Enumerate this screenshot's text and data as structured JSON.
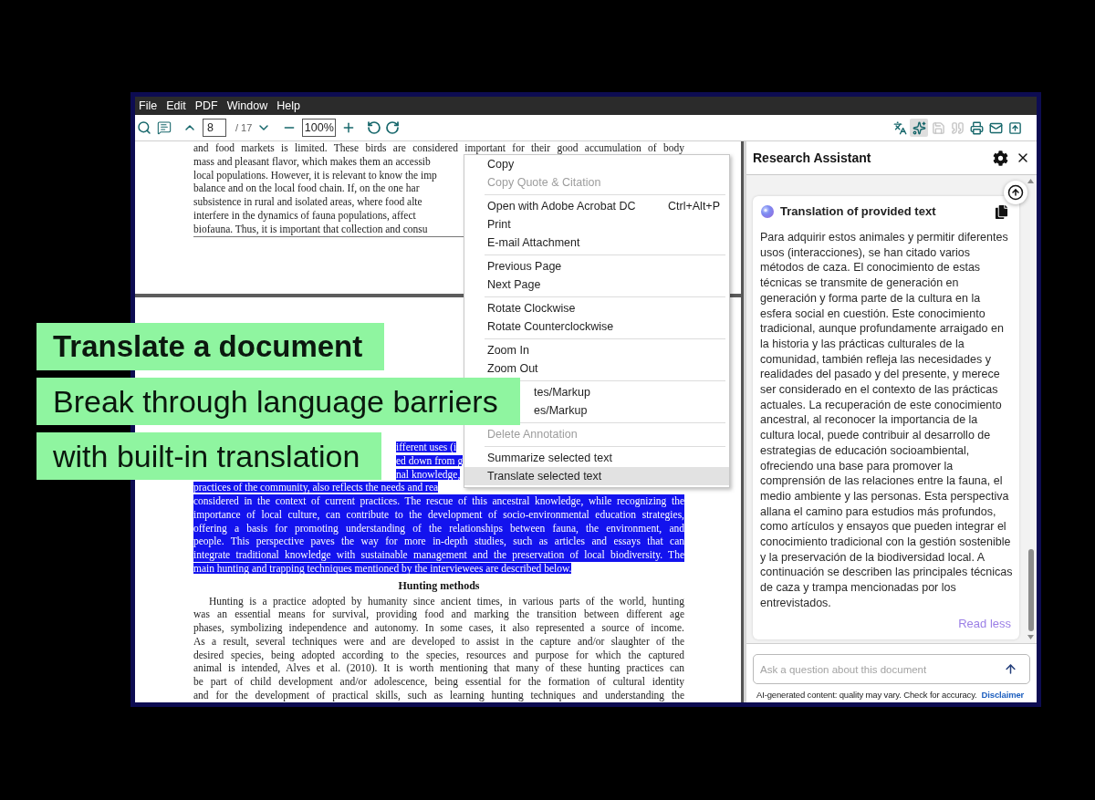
{
  "menubar": [
    "File",
    "Edit",
    "PDF",
    "Window",
    "Help"
  ],
  "toolbar": {
    "page": "8",
    "page_count": "/ 17",
    "zoom": "100%",
    "tools": [
      {
        "selected": false,
        "disabled": false
      },
      {
        "selected": true,
        "disabled": false
      },
      {
        "selected": false,
        "disabled": true
      },
      {
        "selected": false,
        "disabled": true
      },
      {
        "selected": false,
        "disabled": false
      },
      {
        "selected": false,
        "disabled": false
      },
      {
        "selected": false,
        "disabled": false
      }
    ]
  },
  "document": {
    "pages": [
      {
        "blocks": [
          {
            "kind": "paragraph",
            "selected": false,
            "lines": [
              {
                "kind": "justify",
                "text": "and food markets is limited. These birds are considered important for their good accumulation of body"
              },
              {
                "kind": "left",
                "text": "mass and pleasant flavor, which makes them an accessib"
              },
              {
                "kind": "left",
                "text": "local populations. However, it is relevant to know the imp"
              },
              {
                "kind": "left",
                "text": "balance and on the local food chain. If, on the one har"
              },
              {
                "kind": "left",
                "text": "subsistence in rural and isolated areas, where food alte"
              },
              {
                "kind": "left",
                "text": "interfere in the dynamics of fauna populations, affect"
              },
              {
                "kind": "left",
                "text": "biofauna. Thus, it is important that collection and consu"
              }
            ]
          }
        ]
      },
      {
        "blocks": [
          {
            "kind": "paragraph",
            "selected": true,
            "lines": [
              {
                "kind": "offset",
                "text": "ifferent uses (i"
              },
              {
                "kind": "offset",
                "text": "ed down from g"
              },
              {
                "kind": "offset",
                "text": "nal knowledge,"
              },
              {
                "kind": "left",
                "text": "practices of the community, also reflects the needs and rea"
              },
              {
                "kind": "justify",
                "text": "considered in the context of current practices. The rescue of this ancestral knowledge, while recognizing the"
              },
              {
                "kind": "justify",
                "text": "importance of local culture, can contribute to the development of socio-environmental education strategies,"
              },
              {
                "kind": "justify",
                "text": "offering a basis for promoting understanding of the relationships between fauna, the environment, and"
              },
              {
                "kind": "justify",
                "text": "people. This perspective paves the way for more in-depth studies, such as articles and essays that can"
              },
              {
                "kind": "justify",
                "text": "integrate traditional knowledge with sustainable management and the preservation of local biodiversity. The"
              },
              {
                "kind": "left",
                "text": "main hunting and trapping techniques mentioned by the interviewees are described below."
              }
            ]
          },
          {
            "kind": "heading",
            "text": "Hunting methods"
          },
          {
            "kind": "paragraph",
            "selected": false,
            "lines": [
              {
                "kind": "indent",
                "text": "Hunting is a practice adopted by humanity since ancient times, in various parts of the world, hunting"
              },
              {
                "kind": "justify",
                "text": "was an essential means for survival, providing food and marking the transition between different age"
              },
              {
                "kind": "justify",
                "text": "phases, symbolizing independence and autonomy. In some cases, it also represented a source of income."
              },
              {
                "kind": "justify",
                "text": "As a result, several techniques were and are developed to assist in the capture and/or slaughter of the"
              },
              {
                "kind": "justify",
                "text": "desired species, being adopted according to the species, resources and purpose for which the captured"
              },
              {
                "kind": "justify",
                "text": "animal is intended, Alves et al. (2010). It is worth mentioning that many of these hunting practices can"
              },
              {
                "kind": "justify",
                "text": "be part of child development and/or adolescence, being essential for the formation of cultural identity"
              },
              {
                "kind": "justify",
                "text": "and for the development of practical skills, such as learning hunting techniques and understanding the"
              }
            ]
          }
        ]
      }
    ]
  },
  "context_menu": {
    "groups": [
      [
        {
          "kind": "item",
          "label": "Copy",
          "disabled": false,
          "selected": false
        },
        {
          "kind": "item",
          "label": "Copy Quote & Citation",
          "disabled": true,
          "selected": false
        }
      ],
      [
        {
          "kind": "item",
          "label": "Open with Adobe Acrobat DC",
          "shortcut": "Ctrl+Alt+P",
          "disabled": false,
          "selected": false
        },
        {
          "kind": "item",
          "label": "Print",
          "disabled": false,
          "selected": false
        },
        {
          "kind": "item",
          "label": "E-mail Attachment",
          "disabled": false,
          "selected": false
        }
      ],
      [
        {
          "kind": "item",
          "label": "Previous Page",
          "disabled": false,
          "selected": false
        },
        {
          "kind": "item",
          "label": "Next Page",
          "disabled": false,
          "selected": false
        }
      ],
      [
        {
          "kind": "item",
          "label": "Rotate Clockwise",
          "disabled": false,
          "selected": false
        },
        {
          "kind": "item",
          "label": "Rotate Counterclockwise",
          "disabled": false,
          "selected": false
        }
      ],
      [
        {
          "kind": "item",
          "label": "Zoom In",
          "disabled": false,
          "selected": false
        },
        {
          "kind": "item",
          "label": "Zoom Out",
          "disabled": false,
          "selected": false
        }
      ],
      [
        {
          "kind": "clipped",
          "label": "tes/Markup",
          "disabled": false,
          "selected": false
        },
        {
          "kind": "clipped",
          "label": "es/Markup",
          "disabled": false,
          "selected": false
        }
      ],
      [
        {
          "kind": "item",
          "label": "Delete Annotation",
          "disabled": true,
          "selected": false
        }
      ],
      [
        {
          "kind": "item",
          "label": "Summarize selected text",
          "disabled": false,
          "selected": false
        },
        {
          "kind": "item",
          "label": "Translate selected text",
          "disabled": false,
          "selected": true
        }
      ]
    ]
  },
  "assistant": {
    "title": "Research Assistant",
    "card": {
      "title": "Translation of provided text",
      "body": "Para adquirir estos animales y permitir diferentes usos (interacciones), se han citado varios métodos de caza. El conocimiento de estas técnicas se transmite de generación en generación y forma parte de la cultura en la esfera social en cuestión. Este conocimiento tradicional, aunque profundamente arraigado en la historia y las prácticas culturales de la comunidad, también refleja las necesidades y realidades del pasado y del presente, y merece ser considerado en el contexto de las prácticas actuales. La recuperación de este conocimiento ancestral, al reconocer la importancia de la cultura local, puede contribuir al desarrollo de estrategias de educación socioambiental, ofreciendo una base para promover la comprensión de las relaciones entre la fauna, el medio ambiente y las personas. Esta perspectiva allana el camino para estudios más profundos, como artículos y ensayos que pueden integrar el conocimiento tradicional con la gestión sostenible y la preservación de la biodiversidad local. A continuación se describen las principales técnicas de caza y trampa mencionadas por los entrevistados.",
      "toggle": "Read less"
    },
    "input": {
      "placeholder": "Ask a question about this document"
    },
    "footer": {
      "note": "AI-generated content: quality may vary. Check for accuracy.",
      "link": "Disclaimer"
    }
  },
  "banners": [
    {
      "kind": "headline",
      "text": "Translate a document"
    },
    {
      "kind": "subline",
      "text": "Break through language barriers"
    },
    {
      "kind": "subline",
      "text": "with built-in translation"
    }
  ]
}
